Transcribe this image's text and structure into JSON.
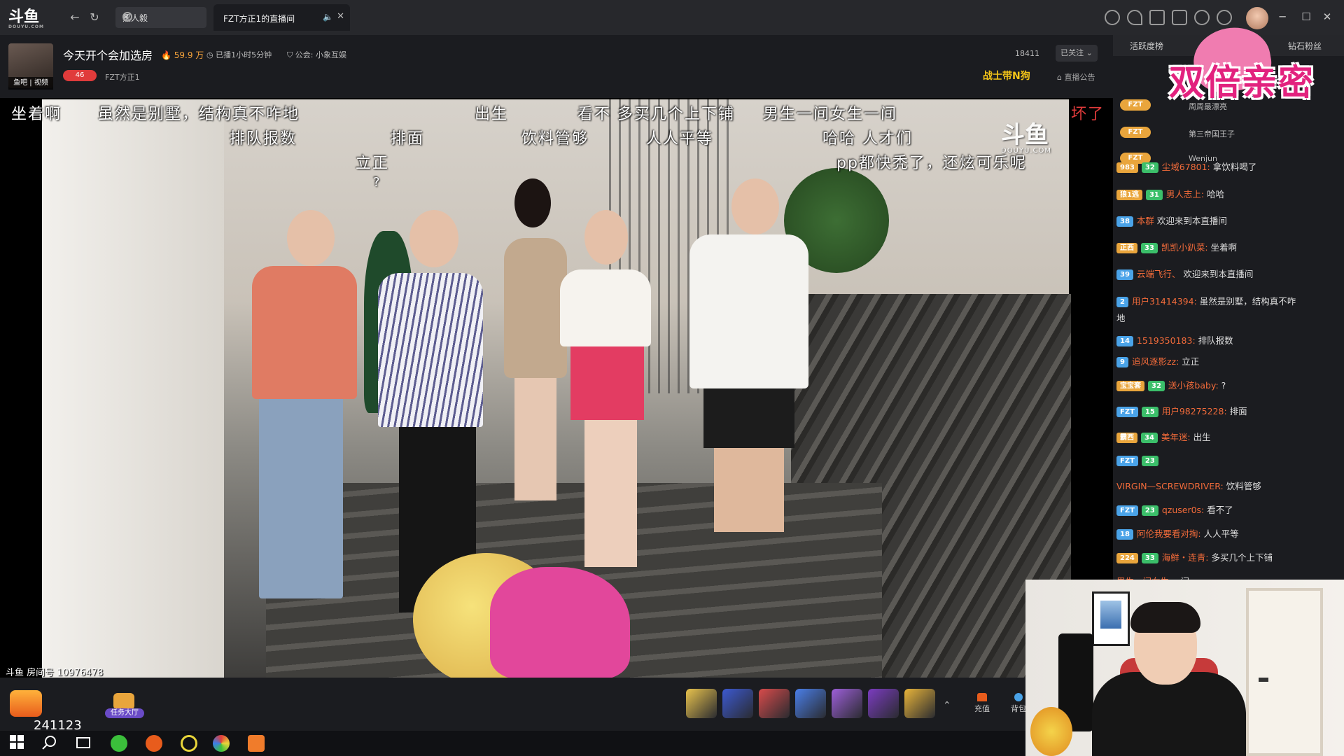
{
  "app": {
    "logo_text": "斗鱼",
    "logo_sub": "DOUYU.COM"
  },
  "search": {
    "value": "黑人毅"
  },
  "tab": {
    "title": "FZT方正1的直播间"
  },
  "stream": {
    "title": "今天开个会加选房",
    "hot": "59.9 万",
    "live_time": "已播1小时5分钟",
    "guild": "公会: 小象互娱",
    "avatar_label": "鱼吧 | 视频",
    "level": "46",
    "streamer_name": "FZT方正1",
    "follow_count": "18411",
    "follow_label": "已关注",
    "fan_badge": "战士带N狗",
    "announce": "直播公告",
    "room_id": "斗鱼 房间号 10976478",
    "watermark": "斗鱼",
    "watermark_sub": "DOUYU.COM"
  },
  "danmu": [
    "坐着啊",
    "虽然是别墅，结构真不咋地",
    "出生",
    "看不 多买几个上下铺",
    "男生一间女生一间",
    "坏了",
    "排队报数",
    "排面",
    "饮料管够",
    "人人平等",
    "哈哈 人才们",
    "立正",
    "pp都快秃了，还炫可乐呢",
    "?"
  ],
  "rank": {
    "tab_active": "活跃度榜",
    "tab_diamond": "钻石粉丝",
    "banner": "双倍亲密",
    "rows": [
      {
        "badge": "FZT",
        "name": "周周最漂亮"
      },
      {
        "badge": "FZT",
        "name": "第三帝国王子"
      },
      {
        "badge": "FZT",
        "name": "Wenjun"
      }
    ]
  },
  "chat": [
    {
      "badges": [
        "983",
        "32"
      ],
      "user": "尘域67801:",
      "text": "拿饮料喝了"
    },
    {
      "badges": [
        "狼1逃",
        "31"
      ],
      "user": "男人志上:",
      "text": "哈哈"
    },
    {
      "badges": [
        "38"
      ],
      "user": "本群",
      "text": "欢迎来到本直播间"
    },
    {
      "badges": [
        "正西",
        "33"
      ],
      "user": "凯凯小趴菜:",
      "text": "坐着啊"
    },
    {
      "badges": [
        "39"
      ],
      "user": "云端飞行、",
      "text": "欢迎来到本直播间"
    },
    {
      "badges": [
        "2"
      ],
      "user": "用户31414394:",
      "text": "虽然是别墅，结构真不咋"
    },
    {
      "badges": [],
      "user": "",
      "text": "地"
    },
    {
      "badges": [
        "14"
      ],
      "user": "1519350183:",
      "text": "排队报数"
    },
    {
      "badges": [
        "9"
      ],
      "user": "追风逐影zz:",
      "text": "立正"
    },
    {
      "badges": [
        "宝宝套",
        "32"
      ],
      "user": "送小孩baby:",
      "text": "?"
    },
    {
      "badges": [
        "FZT",
        "15"
      ],
      "user": "用户98275228:",
      "text": "排面"
    },
    {
      "badges": [
        "霸西",
        "34"
      ],
      "user": "美年迷:",
      "text": "出生"
    },
    {
      "badges": [
        "FZT",
        "23"
      ],
      "user": "",
      "text": ""
    },
    {
      "badges": [],
      "user": "VIRGIN—SCREWDRIVER:",
      "text": "饮料管够"
    },
    {
      "badges": [
        "FZT",
        "23"
      ],
      "user": "qzuser0s:",
      "text": "看不了"
    },
    {
      "badges": [
        "18"
      ],
      "user": "阿伦我要看对掏:",
      "text": "人人平等"
    },
    {
      "badges": [
        "224",
        "33"
      ],
      "user": "海鲜・连青:",
      "text": "多买几个上下铺"
    },
    {
      "badges": [],
      "user": "男生一间女生一",
      "text": "间"
    }
  ],
  "bottom": {
    "fire_count": "241123",
    "task_hall": "任务大厅",
    "recharge": "充值",
    "backpack": "背包",
    "gift_colors": [
      "#e9c34d",
      "#3c59d1",
      "#d84b4b",
      "#4a7ee8",
      "#9d5fd9",
      "#7b3cc0",
      "#e8b43a"
    ]
  },
  "colors": {
    "accent": "#f26b3a",
    "badge_blue": "#4aa3e8",
    "badge_green": "#3bbf6a",
    "badge_orange": "#e9a53c"
  }
}
